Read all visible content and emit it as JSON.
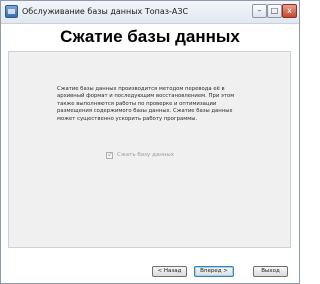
{
  "window": {
    "title": "Обслуживание базы данных Топаз-АЗС",
    "controls": {
      "minimize": "–",
      "maximize": "□",
      "close": "x"
    }
  },
  "header": {
    "title": "Сжатие базы данных"
  },
  "main": {
    "description": "Сжатие базы данных производится методом перевода её в архивный формат и последующим восстановлением. При этом также выполняются работы по проверке и оптимизации размещения содержимого базы данных.  Сжатие базы данных может существенно ускорить работу программы.",
    "checkbox": {
      "label": "Сжать базу данных",
      "checked": true,
      "enabled": false,
      "mark": "✓"
    }
  },
  "footer": {
    "back_label": "< Назад",
    "next_label": "Вперед >",
    "exit_label": "Выход"
  }
}
